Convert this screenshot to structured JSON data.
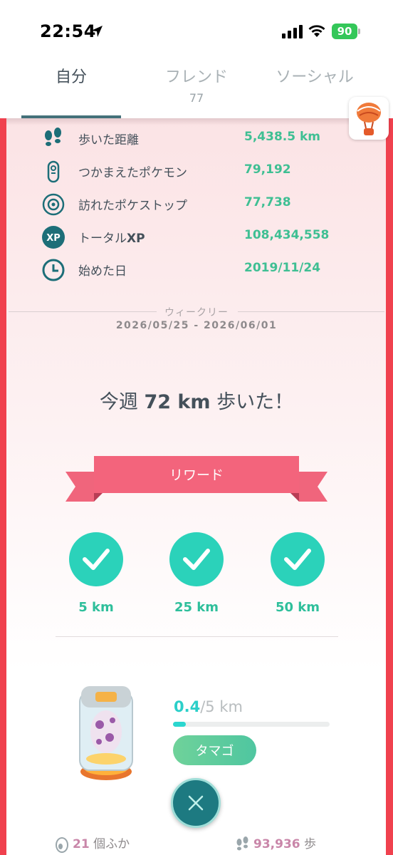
{
  "status_bar": {
    "time": "22:54",
    "battery": "90"
  },
  "tabs": [
    {
      "label": "自分",
      "sub": ""
    },
    {
      "label": "フレンド",
      "sub": "77"
    },
    {
      "label": "ソーシャル",
      "sub": ""
    }
  ],
  "stats": [
    {
      "icon": "footprints-icon",
      "label": "歩いた距離",
      "label_suffix": "",
      "value": "5,438.5 km"
    },
    {
      "icon": "pokeball-tracker-icon",
      "label": "つかまえたポケモン",
      "label_suffix": "",
      "value": "79,192"
    },
    {
      "icon": "pokestop-icon",
      "label": "訪れたポケストップ",
      "label_suffix": "",
      "value": "77,738"
    },
    {
      "icon": "xp-icon",
      "label": "トータル",
      "label_suffix": "XP",
      "value": "108,434,558"
    },
    {
      "icon": "clock-icon",
      "label": "始めた日",
      "label_suffix": "",
      "value": "2019/11/24"
    }
  ],
  "weekly": {
    "title": "ウィークリー",
    "range": "2026/05/25 - 2026/06/01",
    "summary_prefix": "今週 ",
    "summary_value": "72 km",
    "summary_suffix": " 歩いた！"
  },
  "rewards": {
    "banner": "リワード",
    "milestones": [
      {
        "label": "5 km",
        "achieved": true
      },
      {
        "label": "25 km",
        "achieved": true
      },
      {
        "label": "50 km",
        "achieved": true
      }
    ]
  },
  "egg": {
    "current": "0.4",
    "total": "/5 km",
    "progress_fraction": 0.08,
    "button_label": "タマゴ",
    "close_icon": "close-icon"
  },
  "footer": {
    "hatched_count": "21",
    "hatched_unit": " 個ふか",
    "steps_count": "93,936",
    "steps_unit": " 歩"
  },
  "colors": {
    "accent_red": "#f0414e",
    "value_green": "#3fbf93",
    "teal": "#2bd2ba",
    "ribbon_pink": "#f3647c"
  }
}
